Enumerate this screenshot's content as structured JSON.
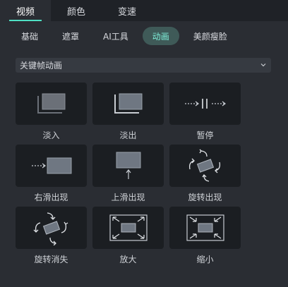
{
  "top_tabs": [
    "视频",
    "颜色",
    "变速"
  ],
  "sub_tabs": [
    "基础",
    "遮罩",
    "AI工具",
    "动画",
    "美颜瘦脸"
  ],
  "dropdown": {
    "label": "关键帧动画"
  },
  "cards": [
    {
      "label": "淡入",
      "icon": "fade-in-icon"
    },
    {
      "label": "淡出",
      "icon": "fade-out-icon"
    },
    {
      "label": "暂停",
      "icon": "pause-icon"
    },
    {
      "label": "右滑出现",
      "icon": "slide-right-icon"
    },
    {
      "label": "上滑出现",
      "icon": "slide-up-icon"
    },
    {
      "label": "旋转出现",
      "icon": "rotate-in-icon"
    },
    {
      "label": "旋转消失",
      "icon": "rotate-out-icon"
    },
    {
      "label": "放大",
      "icon": "zoom-in-icon"
    },
    {
      "label": "缩小",
      "icon": "zoom-out-icon"
    }
  ],
  "colors": {
    "accent": "#4fe0c4",
    "active_pill": "#3f5a58",
    "panel": "#2a2d33",
    "card": "#1b1e22"
  }
}
